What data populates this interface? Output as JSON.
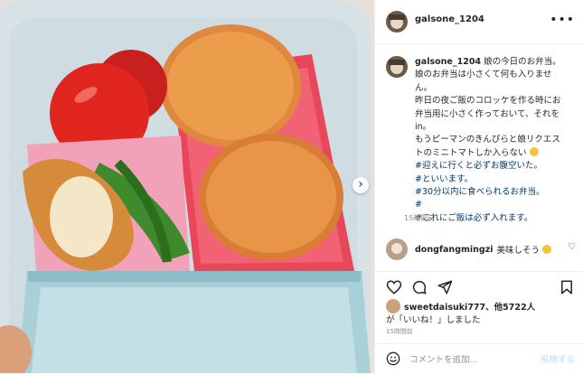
{
  "post": {
    "username": "galsone_1204",
    "more_icon": "more-horizontal-icon"
  },
  "caption": {
    "username": "galsone_1204",
    "lines": [
      "娘の今日のお弁当。",
      "娘のお弁当は小さくて何も入りませ",
      "ん。",
      "昨日の夜ご飯のコロッケを作る時にお",
      "弁当用に小さく作っておいて、それを",
      "in。",
      "もうピーマンのきんぴらと娘リクエス",
      "トのミニトマトしか入らない",
      "#迎えに行くと必ずお腹空いた。",
      "#といいます。",
      "#30分以内に食べられるお弁当。",
      "#",
      "#これにご飯は必ず入れます。"
    ],
    "time_ago": "15時間前"
  },
  "comment": {
    "username": "dongfangmingzi",
    "text": "美味しそう"
  },
  "likes": {
    "user": "sweetdaisuki777",
    "others": "、他5722人",
    "suffix": "が「いいね！」しました"
  },
  "time_ago": "15時間前",
  "add_comment": {
    "placeholder": "コメントを追加...",
    "post_label": "投稿する"
  },
  "colors": {
    "hashtag": "#00376b",
    "post_disabled": "#b2dffc",
    "muted": "#8e8e8e"
  }
}
